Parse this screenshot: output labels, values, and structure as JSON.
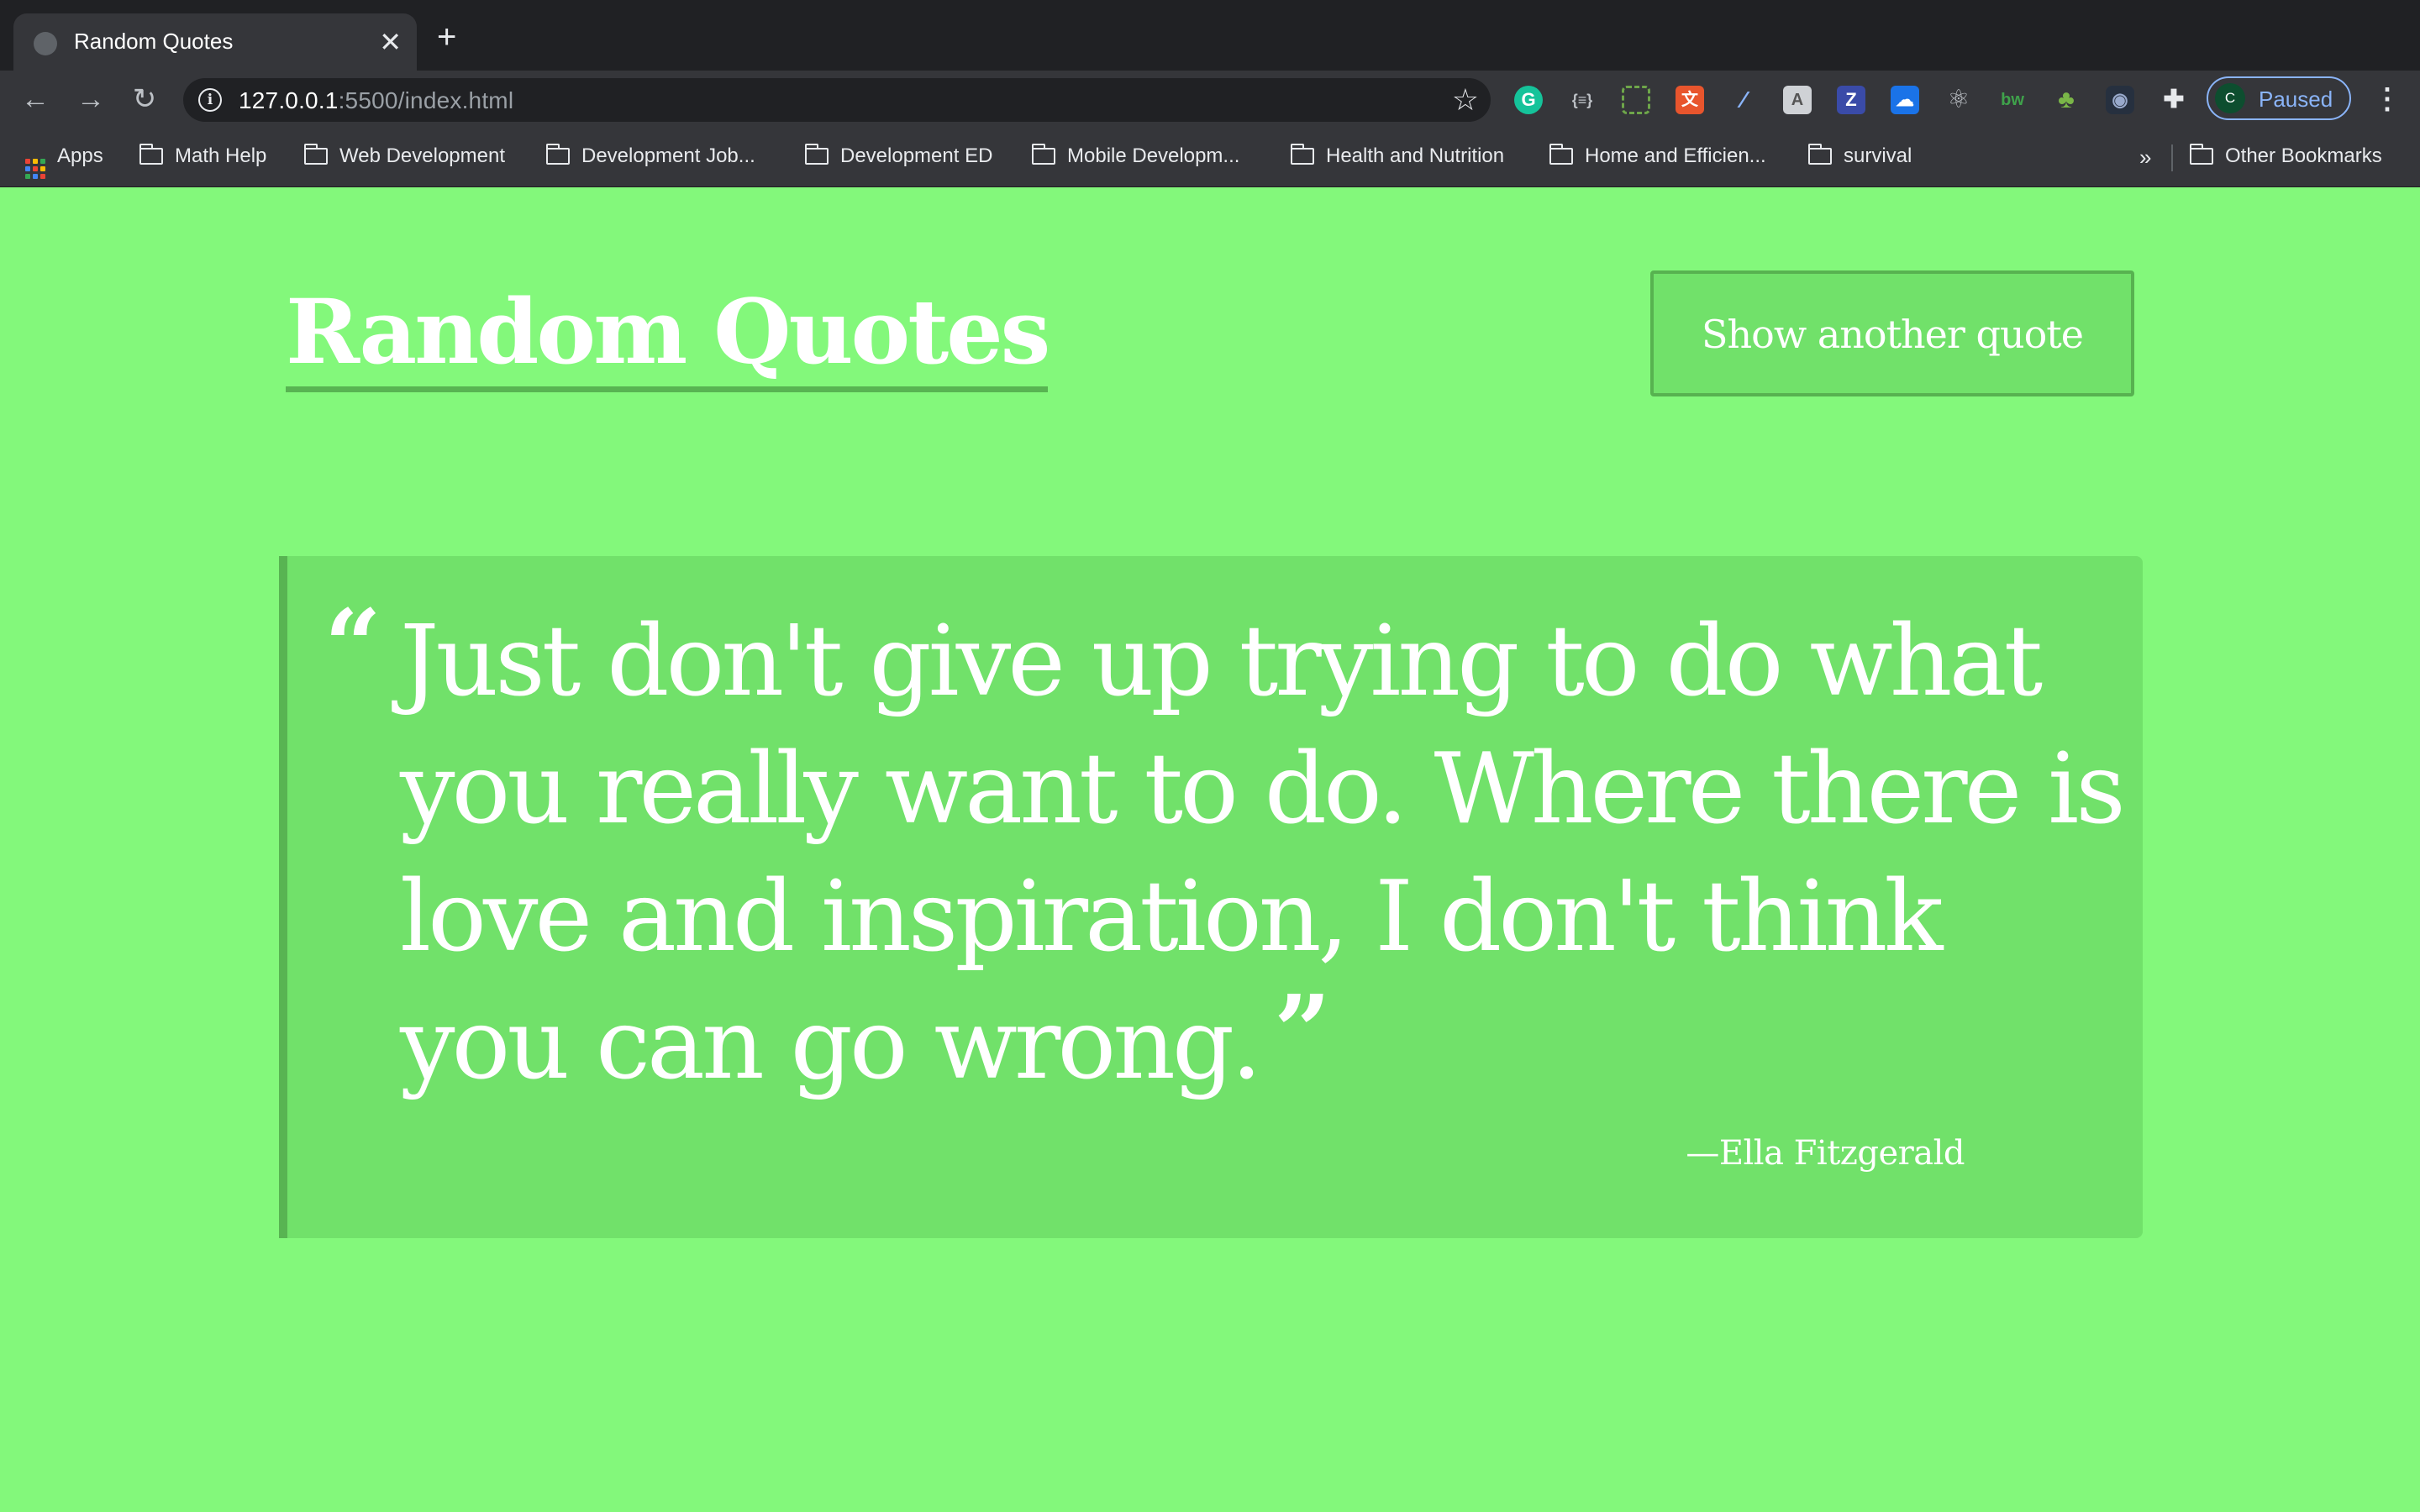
{
  "browser": {
    "tab_title": "Random Quotes",
    "tab_close_icon": "close-icon",
    "new_tab_icon": "plus-icon",
    "url_host": "127.0.0.1",
    "url_rest": ":5500/index.html",
    "extension_icons": [
      "grammarly-icon",
      "json-viewer-icon",
      "screenshot-icon",
      "translate-icon",
      "color-picker-icon",
      "font-icon",
      "zotero-icon",
      "cloud-icon",
      "react-devtools-icon",
      "bw-icon",
      "tree-icon",
      "camera-icon",
      "puzzle-icon"
    ],
    "ext_zotero_label": "Z",
    "ext_bw_label": "bw",
    "profile": {
      "avatar_letter": "C",
      "label": "Paused"
    }
  },
  "bookmarks": {
    "apps_label": "Apps",
    "items": [
      "Math Help",
      "Web Development",
      "Development Job...",
      "Development ED",
      "Mobile Developm...",
      "Health and Nutrition",
      "Home and Efficien...",
      "survival"
    ],
    "overflow_label": "»",
    "other_label": "Other Bookmarks"
  },
  "page": {
    "title": "Random Quotes",
    "button_label": "Show another quote",
    "quote": {
      "open_mark": "“",
      "text": "Just don't give up trying to do what you really want to do. Where there is love and inspiration, I don't think you can go wrong.",
      "close_mark": "”",
      "author": "—Ella Fitzgerald"
    }
  },
  "colors": {
    "page_background": "#83f87b",
    "card_background": "#71e16a",
    "accent_border": "#58b452",
    "text": "#ffffff"
  }
}
